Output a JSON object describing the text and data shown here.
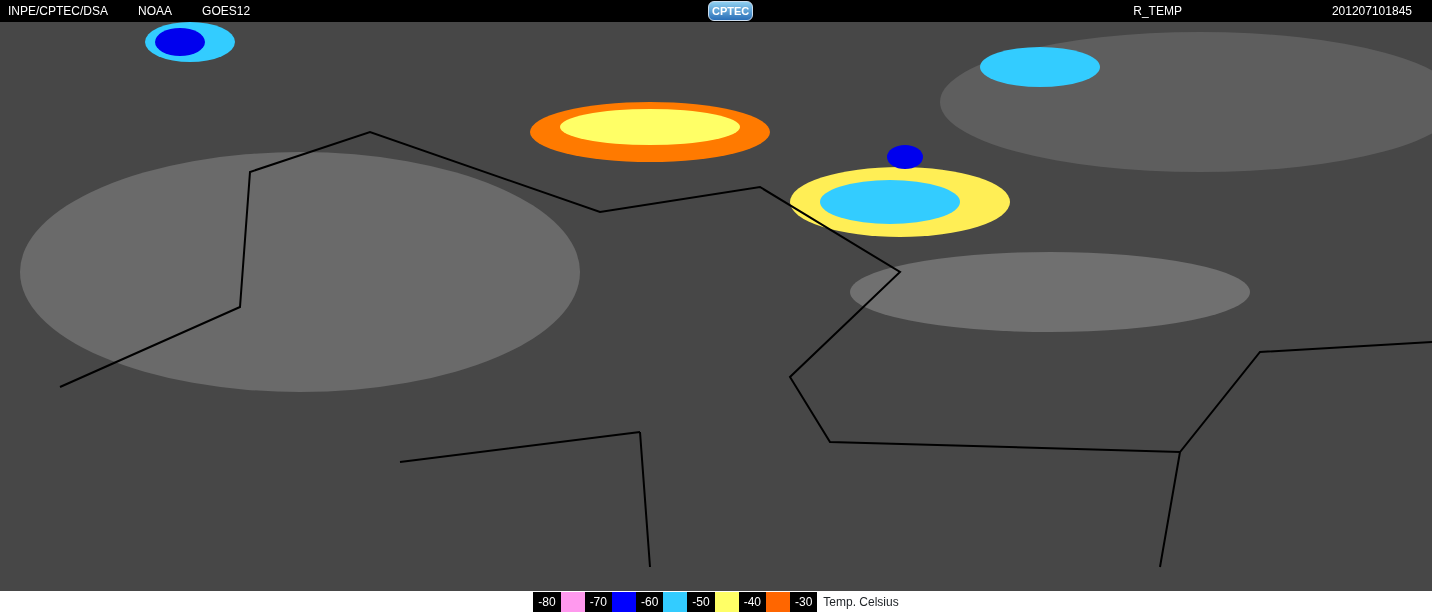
{
  "header": {
    "source": "INPE/CPTEC/DSA",
    "agency": "NOAA",
    "satellite": "GOES12",
    "logo": "CPTEC",
    "product": "R_TEMP",
    "timestamp": "201207101845"
  },
  "legend": {
    "steps": [
      {
        "kind": "label",
        "text": "-80"
      },
      {
        "kind": "swatch",
        "color": "#ff99ee"
      },
      {
        "kind": "label",
        "text": "-70"
      },
      {
        "kind": "swatch",
        "color": "#0000ff"
      },
      {
        "kind": "label",
        "text": "-60"
      },
      {
        "kind": "swatch",
        "color": "#33ccff"
      },
      {
        "kind": "label",
        "text": "-50"
      },
      {
        "kind": "swatch",
        "color": "#ffff66"
      },
      {
        "kind": "label",
        "text": "-40"
      },
      {
        "kind": "swatch",
        "color": "#ff6600"
      },
      {
        "kind": "label",
        "text": "-30"
      }
    ],
    "unit": "Temp. Celsius"
  }
}
